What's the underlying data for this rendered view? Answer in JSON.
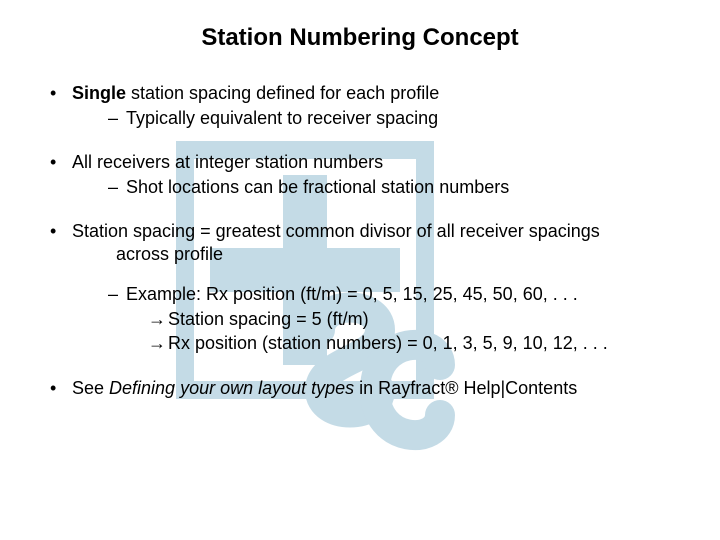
{
  "title": "Station Numbering Concept",
  "bullets": {
    "b1": {
      "strong": "Single",
      "rest": " station spacing defined for each profile",
      "sub1": "Typically equivalent to receiver spacing"
    },
    "b2": {
      "text": "All receivers at integer station numbers",
      "sub1": "Shot locations can be fractional station numbers"
    },
    "b3": {
      "line1": "Station spacing = greatest common divisor of all receiver spacings",
      "line2": "across profile",
      "example_label": "Example: Rx position (ft/m) = 0, 5, 15, 25, 45, 50, 60, . . .",
      "derive1": "Station spacing = 5 (ft/m)",
      "derive2": "Rx position (station numbers) = 0, 1, 3, 5, 9, 10, 12, . . ."
    },
    "b4": {
      "pre": "See ",
      "italic": "Defining your own layout types",
      "post": " in Rayfract® Help|Contents"
    }
  }
}
